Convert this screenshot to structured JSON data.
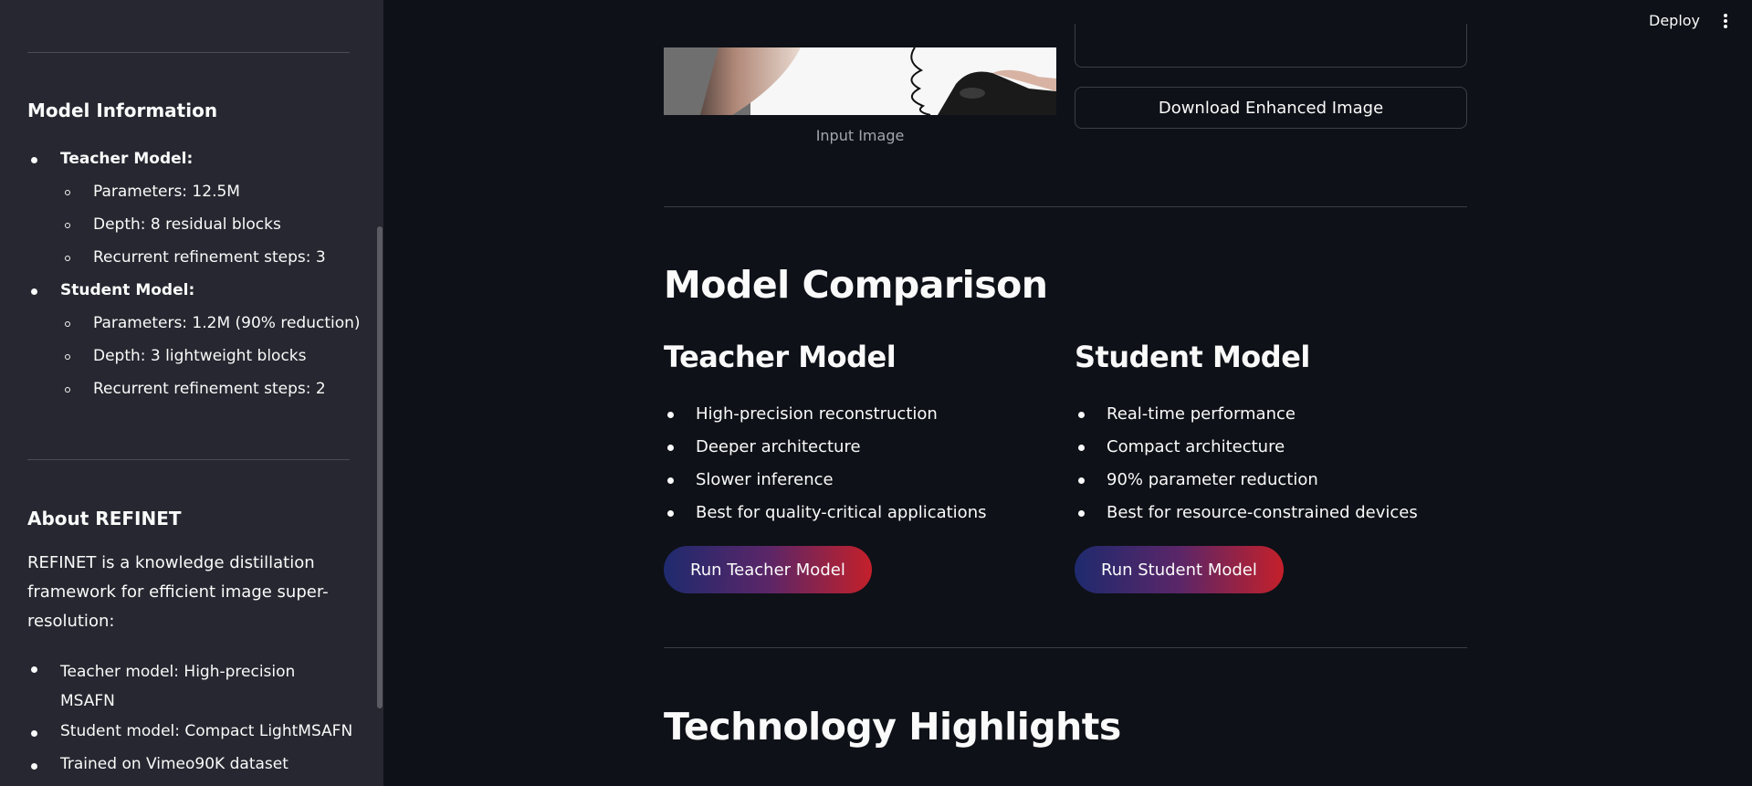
{
  "header": {
    "deploy_label": "Deploy"
  },
  "sidebar": {
    "model_info": {
      "title": "Model Information",
      "teacher_label": "Teacher Model:",
      "teacher_items": [
        "Parameters: 12.5M",
        "Depth: 8 residual blocks",
        "Recurrent refinement steps: 3"
      ],
      "student_label": "Student Model:",
      "student_items": [
        "Parameters: 1.2M (90% reduction)",
        "Depth: 3 lightweight blocks",
        "Recurrent refinement steps: 2"
      ]
    },
    "about": {
      "title": "About REFINET",
      "paragraph": "REFINET is a knowledge distillation framework for efficient image super-resolution:",
      "items": [
        "Teacher model: High-precision MSAFN",
        "Student model: Compact LightMSAFN",
        "Trained on Vimeo90K dataset"
      ]
    }
  },
  "main": {
    "input_image_caption": "Input Image",
    "download_label": "Download Enhanced Image",
    "comparison": {
      "title": "Model Comparison",
      "teacher": {
        "title": "Teacher Model",
        "items": [
          "High-precision reconstruction",
          "Deeper architecture",
          "Slower inference",
          "Best for quality-critical applications"
        ],
        "button": "Run Teacher Model"
      },
      "student": {
        "title": "Student Model",
        "items": [
          "Real-time performance",
          "Compact architecture",
          "90% parameter reduction",
          "Best for resource-constrained devices"
        ],
        "button": "Run Student Model"
      }
    },
    "tech_title": "Technology Highlights"
  },
  "colors": {
    "background": "#0e1117",
    "sidebar": "#262730",
    "gradient_start": "#1f2a6e",
    "gradient_end": "#c4202a"
  }
}
